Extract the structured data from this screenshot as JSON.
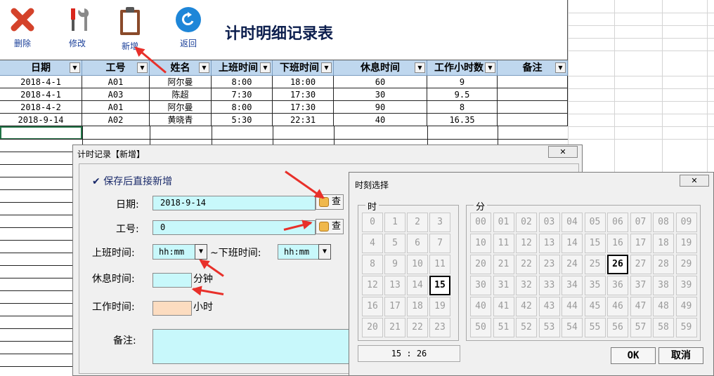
{
  "toolbar": {
    "delete_label": "删除",
    "edit_label": "修改",
    "add_label": "新增",
    "back_label": "返回",
    "title": "计时明细记录表"
  },
  "table": {
    "headers": [
      "日期",
      "工号",
      "姓名",
      "上班时间",
      "下班时间",
      "休息时间",
      "工作小时数",
      "备注"
    ],
    "rows": [
      [
        "2018-4-1",
        "A01",
        "阿尔曼",
        "8:00",
        "18:00",
        "60",
        "9",
        ""
      ],
      [
        "2018-4-1",
        "A03",
        "陈超",
        "7:30",
        "17:30",
        "30",
        "9.5",
        ""
      ],
      [
        "2018-4-2",
        "A01",
        "阿尔曼",
        "8:00",
        "17:30",
        "90",
        "8",
        ""
      ],
      [
        "2018-9-14",
        "A02",
        "黄晓青",
        "5:30",
        "22:31",
        "40",
        "16.35",
        ""
      ]
    ]
  },
  "record_dialog": {
    "title": "计时记录【新增】",
    "close": "✕",
    "checkbox_label": "保存后直接新增",
    "date_label": "日期:",
    "date_value": "2018-9-14",
    "lookup_label": "查",
    "empno_label": "工号:",
    "empno_value": "0",
    "start_label": "上班时间:",
    "start_value": "hh:mm",
    "end_label": "~下班时间:",
    "end_value": "hh:mm",
    "rest_label": "休息时间:",
    "rest_unit": "分钟",
    "work_label": "工作时间:",
    "work_unit": "小时",
    "note_label": "备注:"
  },
  "time_dialog": {
    "title": "时刻选择",
    "close": "✕",
    "hour_group": "时",
    "minute_group": "分",
    "selected_hour": 15,
    "selected_minute": 26,
    "readout": "15 : 26",
    "ok": "OK",
    "cancel": "取消"
  },
  "colors": {
    "header_bg": "#bfd7ee",
    "input_bg": "#c8f8fb",
    "work_input_bg": "#fcdcc0",
    "arrow": "#e8302a",
    "title_color": "#0d1f4e"
  }
}
